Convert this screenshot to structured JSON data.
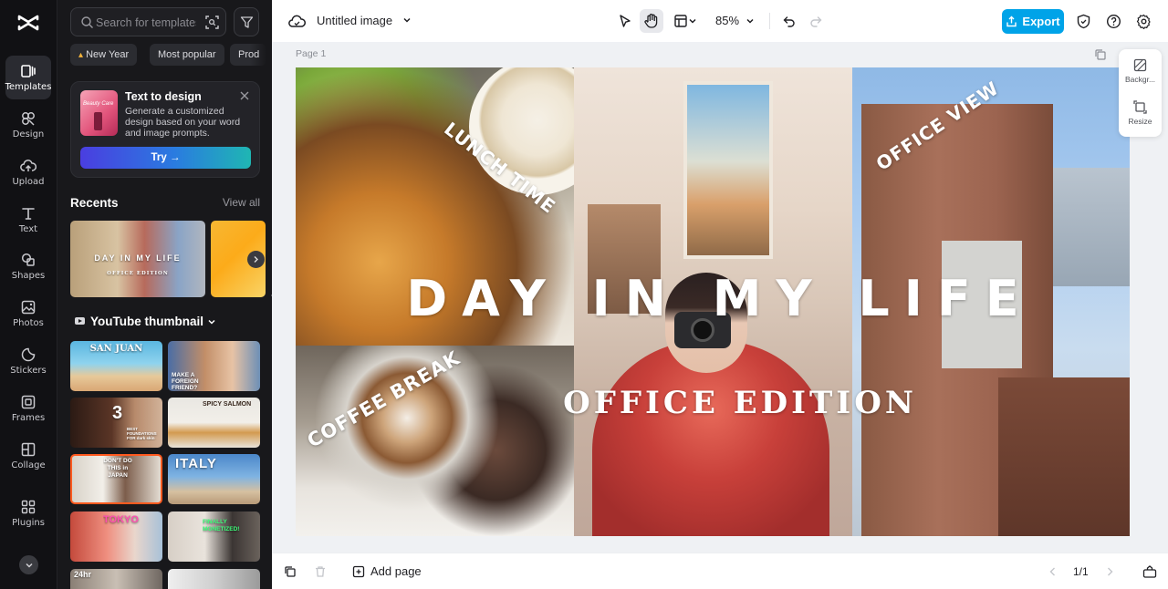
{
  "rail": {
    "items": [
      {
        "label": "Templates",
        "icon": "templates-icon",
        "active": true
      },
      {
        "label": "Design",
        "icon": "design-icon"
      },
      {
        "label": "Upload",
        "icon": "upload-icon"
      },
      {
        "label": "Text",
        "icon": "text-icon"
      },
      {
        "label": "Shapes",
        "icon": "shapes-icon"
      },
      {
        "label": "Photos",
        "icon": "photos-icon"
      },
      {
        "label": "Stickers",
        "icon": "stickers-icon"
      },
      {
        "label": "Frames",
        "icon": "frames-icon"
      },
      {
        "label": "Collage",
        "icon": "collage-icon"
      },
      {
        "label": "Plugins",
        "icon": "plugins-icon"
      }
    ]
  },
  "panel": {
    "search_placeholder": "Search for templates",
    "chips": [
      "New Year",
      "Most popular",
      "Prod"
    ],
    "promo": {
      "thumb_text": "Beauty Care",
      "title": "Text to design",
      "description": "Generate a customized design based on your word and image prompts.",
      "button": "Try →"
    },
    "recents": {
      "title": "Recents",
      "view_all": "View all",
      "thumb_caption": "DAY IN MY LIFE",
      "thumb_sub": "OFFICE EDITION"
    },
    "category": {
      "title": "YouTube thumbnail",
      "tiles": [
        {
          "caption": "SAN JUAN",
          "sub": ""
        },
        {
          "caption": "MAKE A FOREIGN FRIEND?",
          "sub": ""
        },
        {
          "caption": "3",
          "sub": "BEST FOUNDATIONS FOR dark skin"
        },
        {
          "caption": "SPICY SALMON",
          "sub": ""
        },
        {
          "caption": "DON'T DO THIS in JAPAN",
          "sub": ""
        },
        {
          "caption": "ITALY",
          "sub": ""
        },
        {
          "caption": "TOKYO",
          "sub": ""
        },
        {
          "caption": "FINALLY MONETIZED!",
          "sub": ""
        },
        {
          "caption": "24hr",
          "sub": ""
        },
        {
          "caption": "",
          "sub": ""
        }
      ]
    }
  },
  "topbar": {
    "doc_title": "Untitled image",
    "zoom": "85%",
    "export_label": "Export",
    "accent": "#00a3e8"
  },
  "canvas": {
    "page_label": "Page 1",
    "headline": "DAY IN MY LIFE",
    "subheadline": "OFFICE EDITION",
    "sticker_lunch": "LUNCH TIME",
    "sticker_coffee": "COFFEE BREAK",
    "sticker_office": "OFFICE VIEW",
    "side_tools": [
      {
        "label": "Backgr...",
        "icon": "background-icon"
      },
      {
        "label": "Resize",
        "icon": "resize-icon"
      }
    ]
  },
  "bottombar": {
    "add_page": "Add page",
    "page_count": "1/1"
  }
}
